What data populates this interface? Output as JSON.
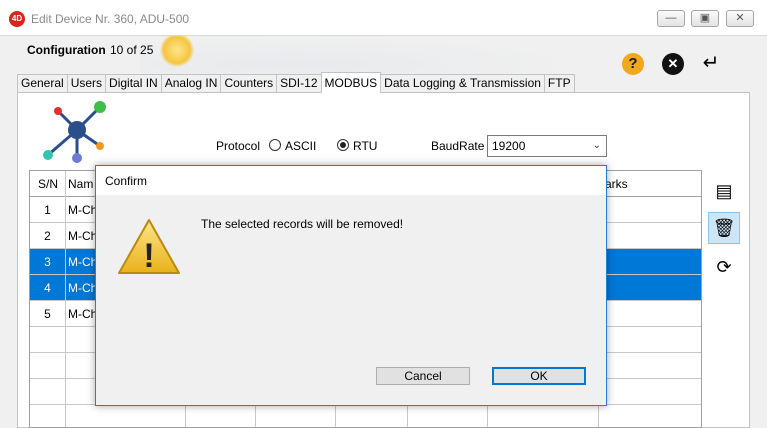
{
  "window": {
    "title": "Edit Device Nr. 360, ADU-500",
    "logo_text": "4D",
    "minimize_glyph": "—",
    "restore_glyph": "▣",
    "close_glyph": "✕"
  },
  "header": {
    "config_label": "Configuration",
    "config_count": "10 of 25",
    "help_glyph": "?",
    "close_glyph": "✕",
    "enter_glyph": "↵"
  },
  "tabs": [
    {
      "label": "General"
    },
    {
      "label": "Users"
    },
    {
      "label": "Digital IN"
    },
    {
      "label": "Analog IN"
    },
    {
      "label": "Counters"
    },
    {
      "label": "SDI-12"
    },
    {
      "label": "MODBUS",
      "active": true
    },
    {
      "label": "Data Logging & Transmission"
    },
    {
      "label": "FTP"
    }
  ],
  "modbus": {
    "protocol_label": "Protocol",
    "ascii_label": "ASCII",
    "rtu_label": "RTU",
    "selected_protocol": "RTU",
    "baud_label": "BaudRate",
    "baud_value": "19200",
    "dropdown_glyph": "⌄"
  },
  "grid": {
    "col_sn": "S/N",
    "col_name": "Nam",
    "col_remarks": "arks",
    "rows": [
      {
        "sn": "1",
        "name": "M-Ch",
        "selected": false
      },
      {
        "sn": "2",
        "name": "M-Ch",
        "selected": false
      },
      {
        "sn": "3",
        "name": "M-Ch",
        "selected": true
      },
      {
        "sn": "4",
        "name": "M-Ch",
        "selected": true
      },
      {
        "sn": "5",
        "name": "M-Ch",
        "selected": false
      }
    ]
  },
  "sidebar": {
    "add_icon": "▤",
    "delete_icon": "🗑",
    "refresh_icon": "⟳"
  },
  "dialog": {
    "title": "Confirm",
    "message": "The selected records will be removed!",
    "warning_glyph": "!",
    "cancel_label": "Cancel",
    "ok_label": "OK"
  },
  "colors": {
    "selection": "#0078d7",
    "dialog_border": "#1883d7",
    "warning": "#f2c230",
    "help": "#f0a81c"
  }
}
